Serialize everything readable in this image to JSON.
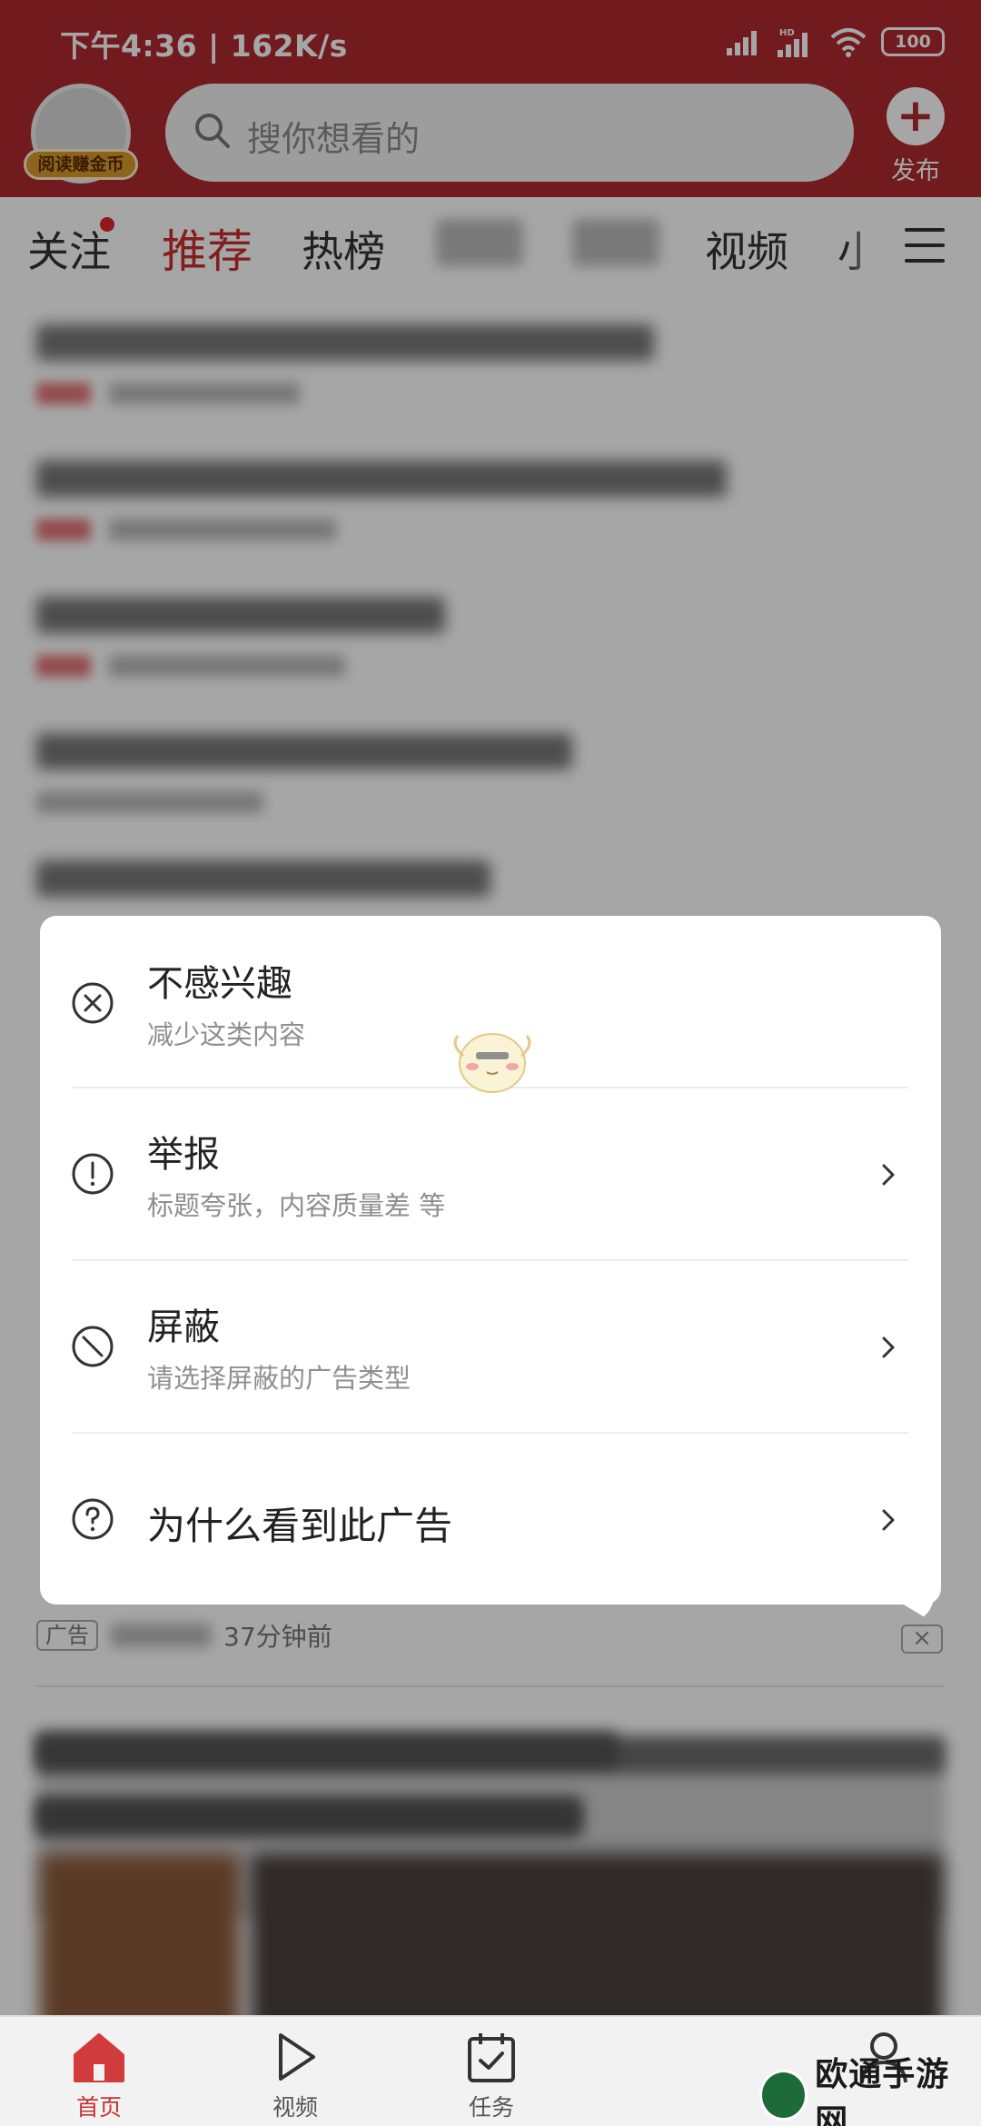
{
  "status_bar": {
    "time": "下午4:36 | 162K/s",
    "battery": "100"
  },
  "header": {
    "coin_badge": "阅读赚金币",
    "search_placeholder": "搜你想看的",
    "publish_label": "发布",
    "publish_symbol": "+",
    "brand_color": "#b02a2e"
  },
  "tabs": {
    "items": [
      {
        "label": "关注",
        "has_dot": true
      },
      {
        "label": "推荐",
        "active": true
      },
      {
        "label": "热榜"
      },
      {
        "label": "",
        "obscured": true
      },
      {
        "label": "",
        "obscured": true
      },
      {
        "label": "视频"
      },
      {
        "label": "小",
        "truncated": true
      }
    ],
    "accent_color": "#c8302f"
  },
  "feed": {
    "ad": {
      "tag": "广告",
      "time": "37分钟前",
      "close_symbol": "×"
    }
  },
  "popup": {
    "items": [
      {
        "title": "不感兴趣",
        "subtitle": "减少这类内容",
        "icon": "close-circle-icon",
        "has_chevron": false
      },
      {
        "title": "举报",
        "subtitle": "标题夸张，内容质量差 等",
        "icon": "exclamation-circle-icon",
        "has_chevron": true
      },
      {
        "title": "屏蔽",
        "subtitle": "请选择屏蔽的广告类型",
        "icon": "block-circle-icon",
        "has_chevron": true
      },
      {
        "title": "为什么看到此广告",
        "subtitle": "",
        "icon": "question-circle-icon",
        "has_chevron": true
      }
    ]
  },
  "bottom_nav": {
    "items": [
      {
        "label": "首页",
        "icon": "home-icon",
        "active": true
      },
      {
        "label": "视频",
        "icon": "play-icon"
      },
      {
        "label": "任务",
        "icon": "calendar-check-icon"
      },
      {
        "label": "",
        "icon": "user-icon"
      }
    ]
  },
  "watermark": {
    "text": "欧通手游网"
  }
}
